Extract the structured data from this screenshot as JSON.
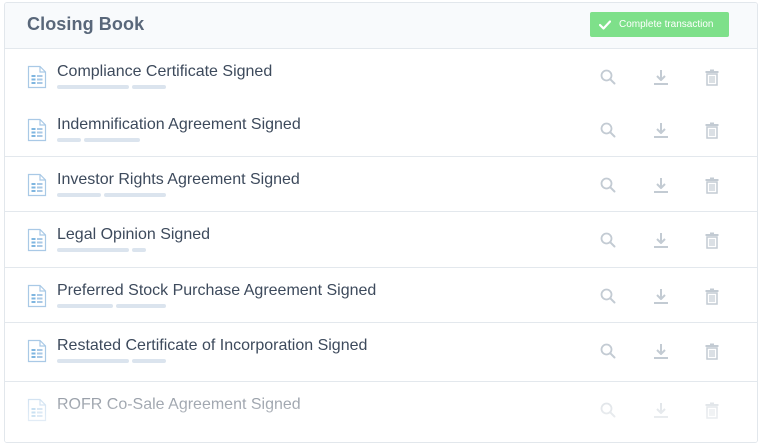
{
  "header": {
    "title": "Closing Book",
    "complete_label": "Complete transaction"
  },
  "icons": {
    "document": "document-icon",
    "search": "search-icon",
    "download": "download-icon",
    "delete": "trash-icon",
    "check": "check-icon"
  },
  "colors": {
    "accent_green": "#7ee08a",
    "title_gray": "#59677a",
    "icon_gray": "#c3cbd3",
    "doc_icon_blue": "#7fb6e0"
  },
  "documents": [
    {
      "name": "Compliance Certificate Signed"
    },
    {
      "name": "Indemnification Agreement Signed"
    },
    {
      "name": "Investor Rights Agreement Signed"
    },
    {
      "name": "Legal Opinion Signed"
    },
    {
      "name": "Preferred Stock Purchase Agreement Signed"
    },
    {
      "name": "Restated Certificate of Incorporation Signed"
    },
    {
      "name": "ROFR Co-Sale Agreement Signed"
    }
  ]
}
